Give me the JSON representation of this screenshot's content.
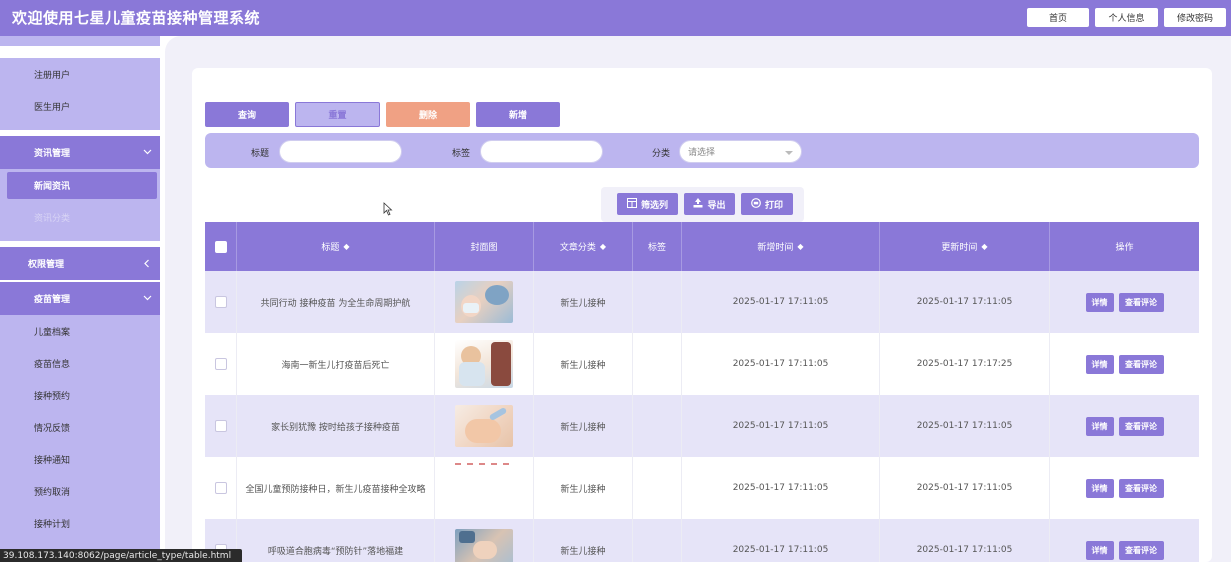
{
  "header": {
    "title": "欢迎使用七星儿童疫苗接种管理系统",
    "buttons": [
      "首页",
      "个人信息",
      "修改密码"
    ],
    "color": "#8a78d8"
  },
  "sidebar": {
    "items": [
      {
        "label": "注册用户",
        "type": "item"
      },
      {
        "label": "医生用户",
        "type": "item"
      },
      {
        "label": "资讯管理",
        "type": "group",
        "expanded": true
      },
      {
        "label": "新闻资讯",
        "type": "active"
      },
      {
        "label": "资讯分类",
        "type": "muted"
      },
      {
        "label": "权限管理",
        "type": "group",
        "expanded": false
      },
      {
        "label": "疫苗管理",
        "type": "group",
        "expanded": true
      },
      {
        "label": "儿童档案",
        "type": "item"
      },
      {
        "label": "疫苗信息",
        "type": "item"
      },
      {
        "label": "接种预约",
        "type": "item"
      },
      {
        "label": "情况反馈",
        "type": "item"
      },
      {
        "label": "接种通知",
        "type": "item"
      },
      {
        "label": "预约取消",
        "type": "item"
      },
      {
        "label": "接种计划",
        "type": "item"
      }
    ]
  },
  "actions": {
    "query": "查询",
    "reset": "重置",
    "delete": "删除",
    "add": "新增"
  },
  "filters": {
    "title_label": "标题",
    "tag_label": "标签",
    "category_label": "分类",
    "category_placeholder": "请选择"
  },
  "tools": {
    "columns": "筛选列",
    "export": "导出",
    "print": "打印"
  },
  "table": {
    "columns": [
      "标题",
      "封面图",
      "文章分类",
      "标签",
      "新增时间",
      "更新时间",
      "操作"
    ],
    "rows": [
      {
        "title": "共同行动 接种疫苗 为全生命周期护航",
        "category": "新生儿接种",
        "tag": "",
        "created": "2025-01-17 17:11:05",
        "updated": "2025-01-17 17:11:05"
      },
      {
        "title": "海南一新生儿打疫苗后死亡",
        "category": "新生儿接种",
        "tag": "",
        "created": "2025-01-17 17:11:05",
        "updated": "2025-01-17 17:17:25"
      },
      {
        "title": "家长别犹豫 按时给孩子接种疫苗",
        "category": "新生儿接种",
        "tag": "",
        "created": "2025-01-17 17:11:05",
        "updated": "2025-01-17 17:11:05"
      },
      {
        "title": "全国儿童预防接种日，新生儿疫苗接种全攻略",
        "category": "新生儿接种",
        "tag": "",
        "created": "2025-01-17 17:11:05",
        "updated": "2025-01-17 17:11:05"
      },
      {
        "title": "呼吸道合胞病毒“预防针”落地福建",
        "category": "新生儿接种",
        "tag": "",
        "created": "2025-01-17 17:11:05",
        "updated": "2025-01-17 17:11:05"
      }
    ],
    "detail_label": "详情",
    "comment_label": "查看评论"
  },
  "statusbar": {
    "url": "39.108.173.140:8062/page/article_type/table.html"
  },
  "icons": [
    "columns-icon",
    "export-icon",
    "print-icon",
    "chevron-down-icon",
    "chevron-left-icon",
    "sort-icon",
    "cursor-icon"
  ]
}
